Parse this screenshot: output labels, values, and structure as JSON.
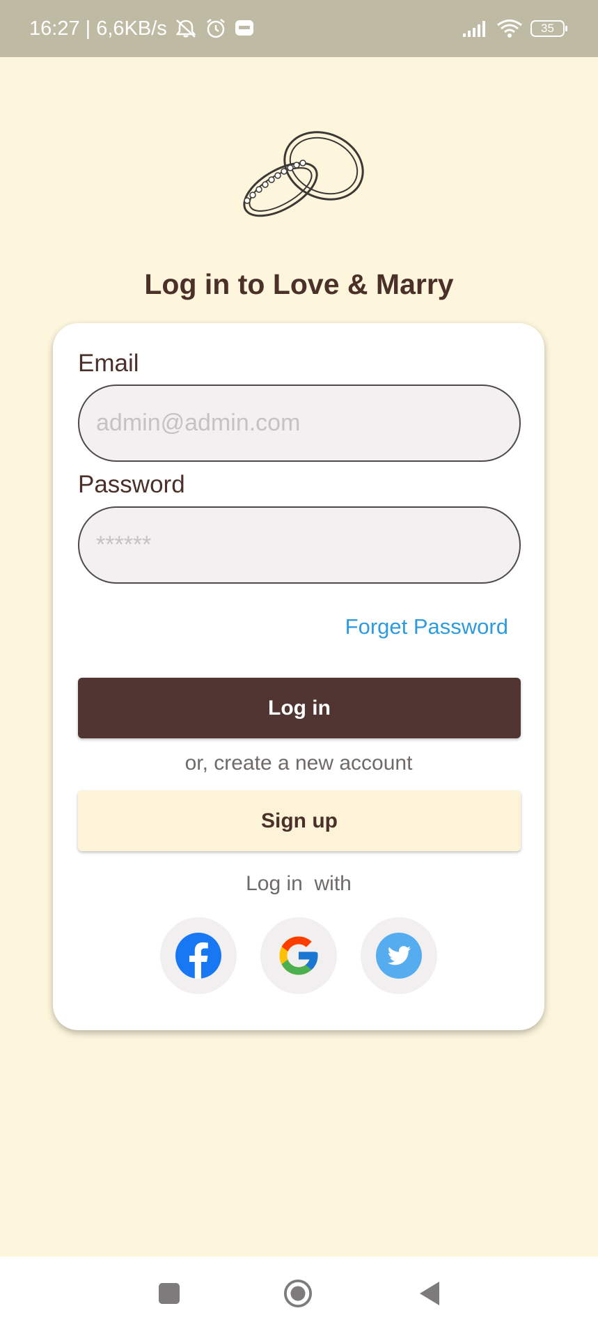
{
  "status_bar": {
    "time_speed": "16:27 | 6,6KB/s",
    "battery": "35",
    "icons": [
      "mute-icon",
      "alarm-icon",
      "zalo-icon",
      "signal-icon",
      "wifi-icon",
      "battery-icon"
    ]
  },
  "app": {
    "title": "Log in to Love & Marry",
    "logo": "wedding-rings-icon"
  },
  "form": {
    "email_label": "Email",
    "email_placeholder": "admin@admin.com",
    "email_value": "",
    "password_label": "Password",
    "password_placeholder": "******",
    "password_value": "",
    "forget_password": "Forget Password",
    "login_button": "Log in",
    "or_text": "or, create a new account",
    "signup_button": "Sign up",
    "login_with": "Log in  with"
  },
  "social": [
    {
      "name": "facebook",
      "icon": "facebook-icon"
    },
    {
      "name": "google",
      "icon": "google-icon"
    },
    {
      "name": "twitter",
      "icon": "twitter-icon"
    }
  ],
  "colors": {
    "background": "#fdf6dc",
    "primary": "#503532",
    "link": "#2e9bdc",
    "status_bar": "#bfbaa3"
  },
  "nav_bar": {
    "buttons": [
      "recents-button",
      "home-button",
      "back-button"
    ]
  }
}
